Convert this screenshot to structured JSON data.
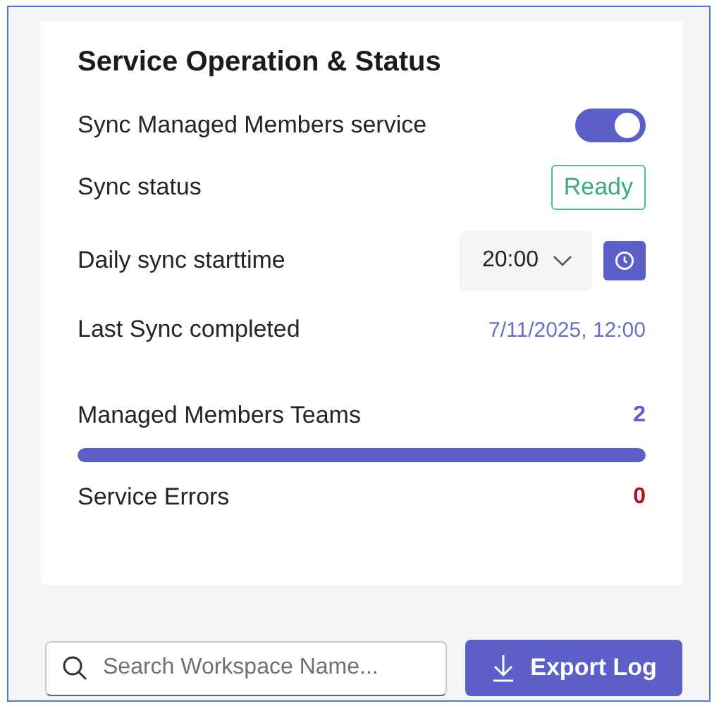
{
  "card": {
    "title": "Service Operation & Status",
    "sync_service": {
      "label": "Sync Managed Members service",
      "on": true
    },
    "sync_status": {
      "label": "Sync status",
      "badge": "Ready"
    },
    "daily_start": {
      "label": "Daily sync starttime",
      "value": "20:00"
    },
    "last_sync": {
      "label": "Last Sync completed",
      "value": "7/11/2025, 12:00"
    },
    "teams": {
      "label": "Managed Members Teams",
      "value": "2",
      "level": 1
    },
    "errors": {
      "label": "Service Errors",
      "value": "0"
    }
  },
  "search": {
    "placeholder": "Search Workspace Name..."
  },
  "export_button": {
    "label": "Export Log"
  }
}
